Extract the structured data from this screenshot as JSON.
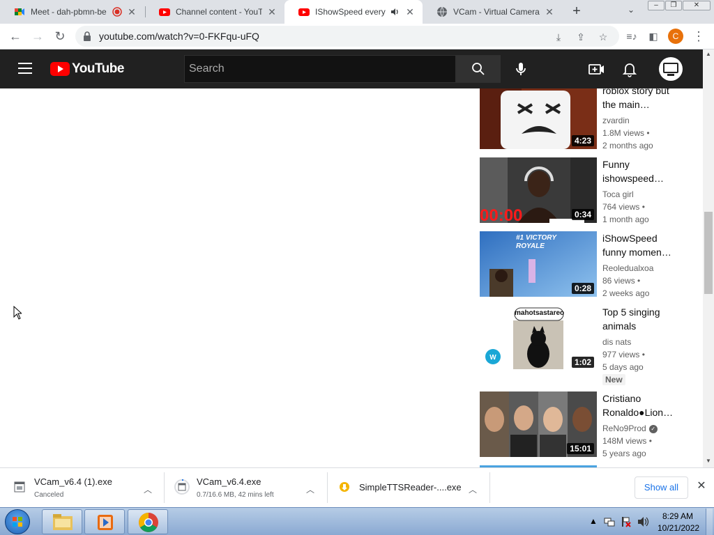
{
  "browser": {
    "tabs": [
      {
        "title": "Meet - dah-pbmn-be",
        "favicon": "google-meet-icon",
        "active": false
      },
      {
        "title": "Channel content - YouTube",
        "favicon": "youtube-icon",
        "active": false
      },
      {
        "title": "IShowSpeed every m",
        "favicon": "youtube-icon",
        "active": true
      },
      {
        "title": "VCam - Virtual Camera | E",
        "favicon": "globe-icon",
        "active": false
      }
    ],
    "url": "youtube.com/watch?v=0-FKFqu-uFQ",
    "profile_initial": "C"
  },
  "youtube": {
    "logo_text": "YouTube",
    "search_placeholder": "Search"
  },
  "recommendations": [
    {
      "title_line1": "roblox story but",
      "title_line2": "the main…",
      "channel": "zvardin",
      "views": "1.8M views •",
      "age": "2 months ago",
      "duration": "4:23",
      "badge": "",
      "verified": false
    },
    {
      "title_line1": "Funny",
      "title_line2": "ishowspeed…",
      "channel": "Toca girl",
      "views": "764 views •",
      "age": "1 month ago",
      "duration": "0:34",
      "badge": "",
      "verified": false,
      "thumb_text": "00:00"
    },
    {
      "title_line1": "iShowSpeed",
      "title_line2": "funny momen…",
      "channel": "Reoledualxoa",
      "views": "86 views •",
      "age": "2 weeks ago",
      "duration": "0:28",
      "badge": "",
      "verified": false,
      "thumb_text": "#1 VICTORY ROYALE"
    },
    {
      "title_line1": "Top 5 singing",
      "title_line2": "animals",
      "channel": "dis nats",
      "views": "977 views •",
      "age": "5 days ago",
      "duration": "1:02",
      "badge": "New",
      "verified": false,
      "thumb_text": "mahotsastareo"
    },
    {
      "title_line1": "Cristiano",
      "title_line2": "Ronaldo●Lion…",
      "channel": "ReNo9Prod",
      "views": "148M views •",
      "age": "5 years ago",
      "duration": "15:01",
      "badge": "",
      "verified": true
    }
  ],
  "downloads": [
    {
      "name": "VCam_v6.4 (1).exe",
      "status": "Canceled"
    },
    {
      "name": "VCam_v6.4.exe",
      "status": "0.7/16.6 MB, 42 mins left"
    },
    {
      "name": "SimpleTTSReader-....exe",
      "status": ""
    }
  ],
  "download_shelf": {
    "show_all": "Show all"
  },
  "taskbar": {
    "time": "8:29 AM",
    "date": "10/21/2022"
  }
}
